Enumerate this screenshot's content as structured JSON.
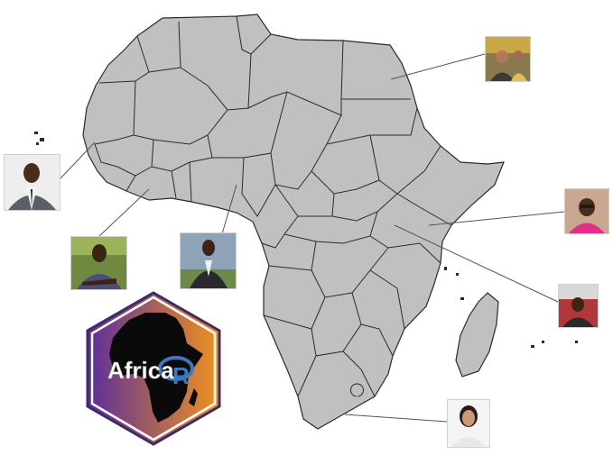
{
  "map": {
    "land_color": "#c0c0c0",
    "border_color": "#2b2b2b",
    "pointer_color": "#555555"
  },
  "profiles": [
    {
      "name": "profile-egypt",
      "icon": "person-photo"
    },
    {
      "name": "profile-senegal",
      "icon": "person-photo"
    },
    {
      "name": "profile-ghana",
      "icon": "person-photo"
    },
    {
      "name": "profile-nigeria",
      "icon": "person-photo"
    },
    {
      "name": "profile-kenya",
      "icon": "person-photo"
    },
    {
      "name": "profile-uganda",
      "icon": "person-photo"
    },
    {
      "name": "profile-south-africa",
      "icon": "person-photo"
    }
  ],
  "logo": {
    "text": "Africa",
    "letter": "R",
    "gradient_left": "#5b2d9c",
    "gradient_right": "#f0921e",
    "ring_color": "#3a78c2"
  }
}
